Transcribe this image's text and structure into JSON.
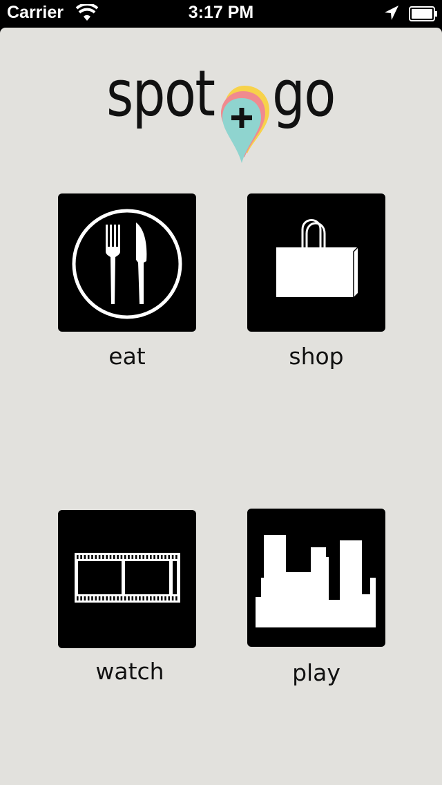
{
  "status_bar": {
    "carrier": "Carrier",
    "time": "3:17 PM",
    "icons": [
      "wifi-icon",
      "location-arrow-icon",
      "battery-icon"
    ]
  },
  "logo": {
    "left_word": "spot",
    "right_word": "go",
    "pin_symbol": "+",
    "pin_colors": [
      "#f7d24a",
      "#f08a8f",
      "#8fd4cf"
    ]
  },
  "categories": [
    {
      "label": "eat",
      "icon": "plate-fork-knife-icon"
    },
    {
      "label": "shop",
      "icon": "shopping-bag-icon"
    },
    {
      "label": "watch",
      "icon": "film-strip-icon"
    },
    {
      "label": "play",
      "icon": "city-skyline-icon"
    }
  ],
  "colors": {
    "background": "#e2e1dd",
    "tile": "#000000",
    "icon": "#ffffff",
    "text": "#111111"
  }
}
